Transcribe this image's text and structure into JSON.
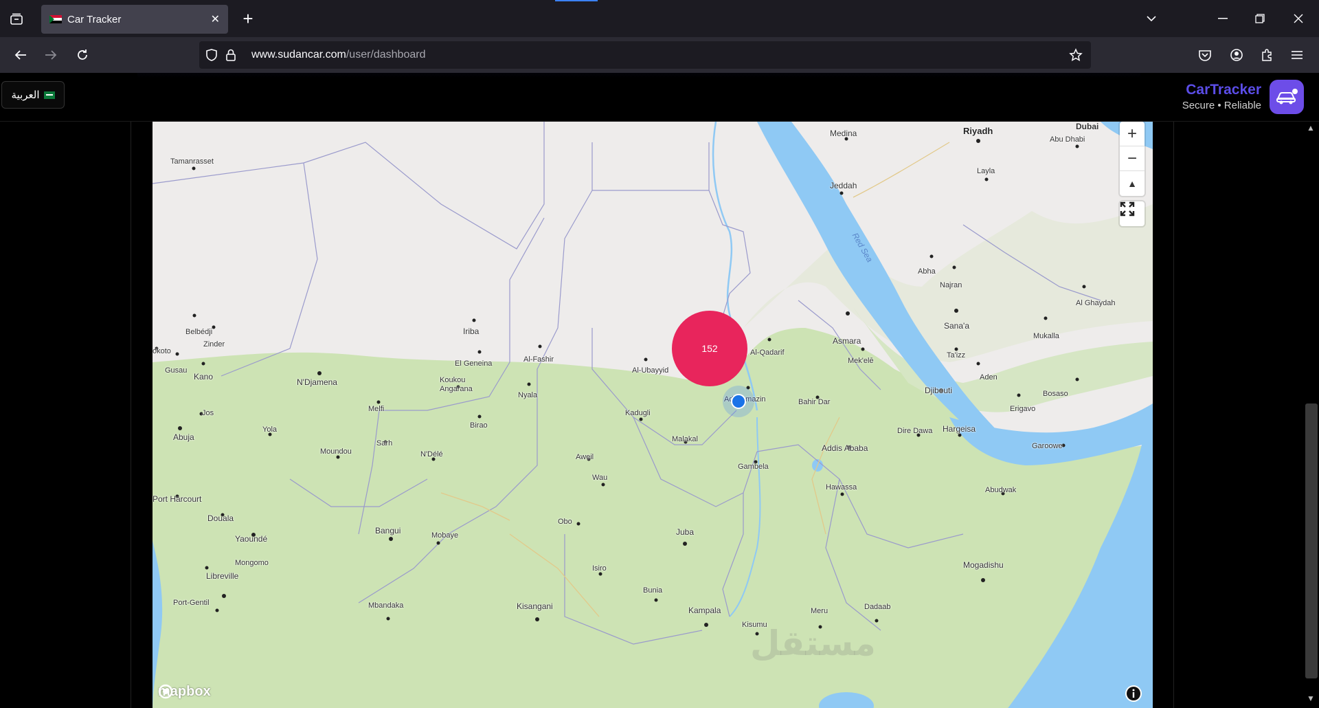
{
  "browser": {
    "tab": {
      "title": "Car Tracker",
      "close": "✕"
    },
    "new_tab": "+",
    "url": {
      "host": "www.sudancar.com",
      "path": "/user/dashboard"
    },
    "icons": [
      "tab-list-icon",
      "back-icon",
      "forward-icon",
      "reload-icon",
      "shield-icon",
      "lock-icon",
      "bookmark-star-icon",
      "pocket-icon",
      "account-icon",
      "extensions-icon",
      "menu-icon"
    ]
  },
  "header": {
    "language_button": "العربية",
    "brand_name": "CarTracker",
    "brand_tagline": "Secure • Reliable"
  },
  "map": {
    "cluster_count": "152",
    "zoom_in": "+",
    "zoom_out": "−",
    "compass": "▲",
    "attribution": "mapbox",
    "watermark": "مستقل",
    "places": {
      "medina": "Medina",
      "riyadh": "Riyadh",
      "dubai": "Dubai",
      "abu_dhabi": "Abu Dhabi",
      "tamanrasset": "Tamanrasset",
      "layla": "Layla",
      "jeddah": "Jeddah",
      "red_sea": "Red Sea",
      "abha": "Abha",
      "najran": "Najran",
      "al_ghaydah": "Al Ghaydah",
      "belbedji": "Belbédji",
      "iriba": "Iriba",
      "sanaa": "Sana'a",
      "mukalla": "Mukalla",
      "zinder": "Zinder",
      "asmara": "Asmara",
      "al_qadarif": "Al-Qadarif",
      "okoto": "okoto",
      "gusau": "Gusau",
      "el_geneina": "El Geneina",
      "al_fashir": "Al-Fashir",
      "al_ubayyid": "Al-Ubayyid",
      "mekele": "Mek'elē",
      "taizz": "Ta'izz",
      "kano": "Kano",
      "ndjamena": "N'Djamena",
      "aden": "Aden",
      "koukou": "Koukou Angarana",
      "nyala": "Nyala",
      "ad_damazin": "Ad-Damazin",
      "djibouti": "Djibouti",
      "bosaso": "Bosaso",
      "bahir_dar": "Bahir Dar",
      "erigavo": "Erigavo",
      "melfi": "Melfi",
      "jos": "Jos",
      "kadugli": "Kadugli",
      "birao": "Birao",
      "abuja": "Abuja",
      "yola": "Yola",
      "dire_dawa": "Dire Dawa",
      "hargeisa": "Hargeisa",
      "sarh": "Sarh",
      "malakal": "Malakal",
      "addis_ababa": "Addis Ababa",
      "garoowe": "Garoowe",
      "moundou": "Moundou",
      "ndele": "N'Délé",
      "aweil": "Aweil",
      "gambela": "Gambela",
      "wau": "Wau",
      "hawassa": "Hawassa",
      "abudwak": "Abudwak",
      "port_harcourt": "Port Harcourt",
      "obo": "Obo",
      "douala": "Douala",
      "bangui": "Bangui",
      "juba": "Juba",
      "mobaye": "Mobaye",
      "yaounde": "Yaoundé",
      "mongomo": "Mongomo",
      "isiro": "Isiro",
      "mogadishu": "Mogadishu",
      "libreville": "Libreville",
      "bunia": "Bunia",
      "port_gentil": "Port-Gentil",
      "mbandaka": "Mbandaka",
      "kisangani": "Kisangani",
      "kampala": "Kampala",
      "meru": "Meru",
      "dadaab": "Dadaab",
      "kisumu": "Kisumu"
    }
  },
  "colors": {
    "brand": "#5b4de8",
    "cluster": "#e8255c",
    "locator": "#1a73e8",
    "land_green": "#cfe3b8",
    "desert": "#eeeceb",
    "water": "#8fc9f4"
  }
}
